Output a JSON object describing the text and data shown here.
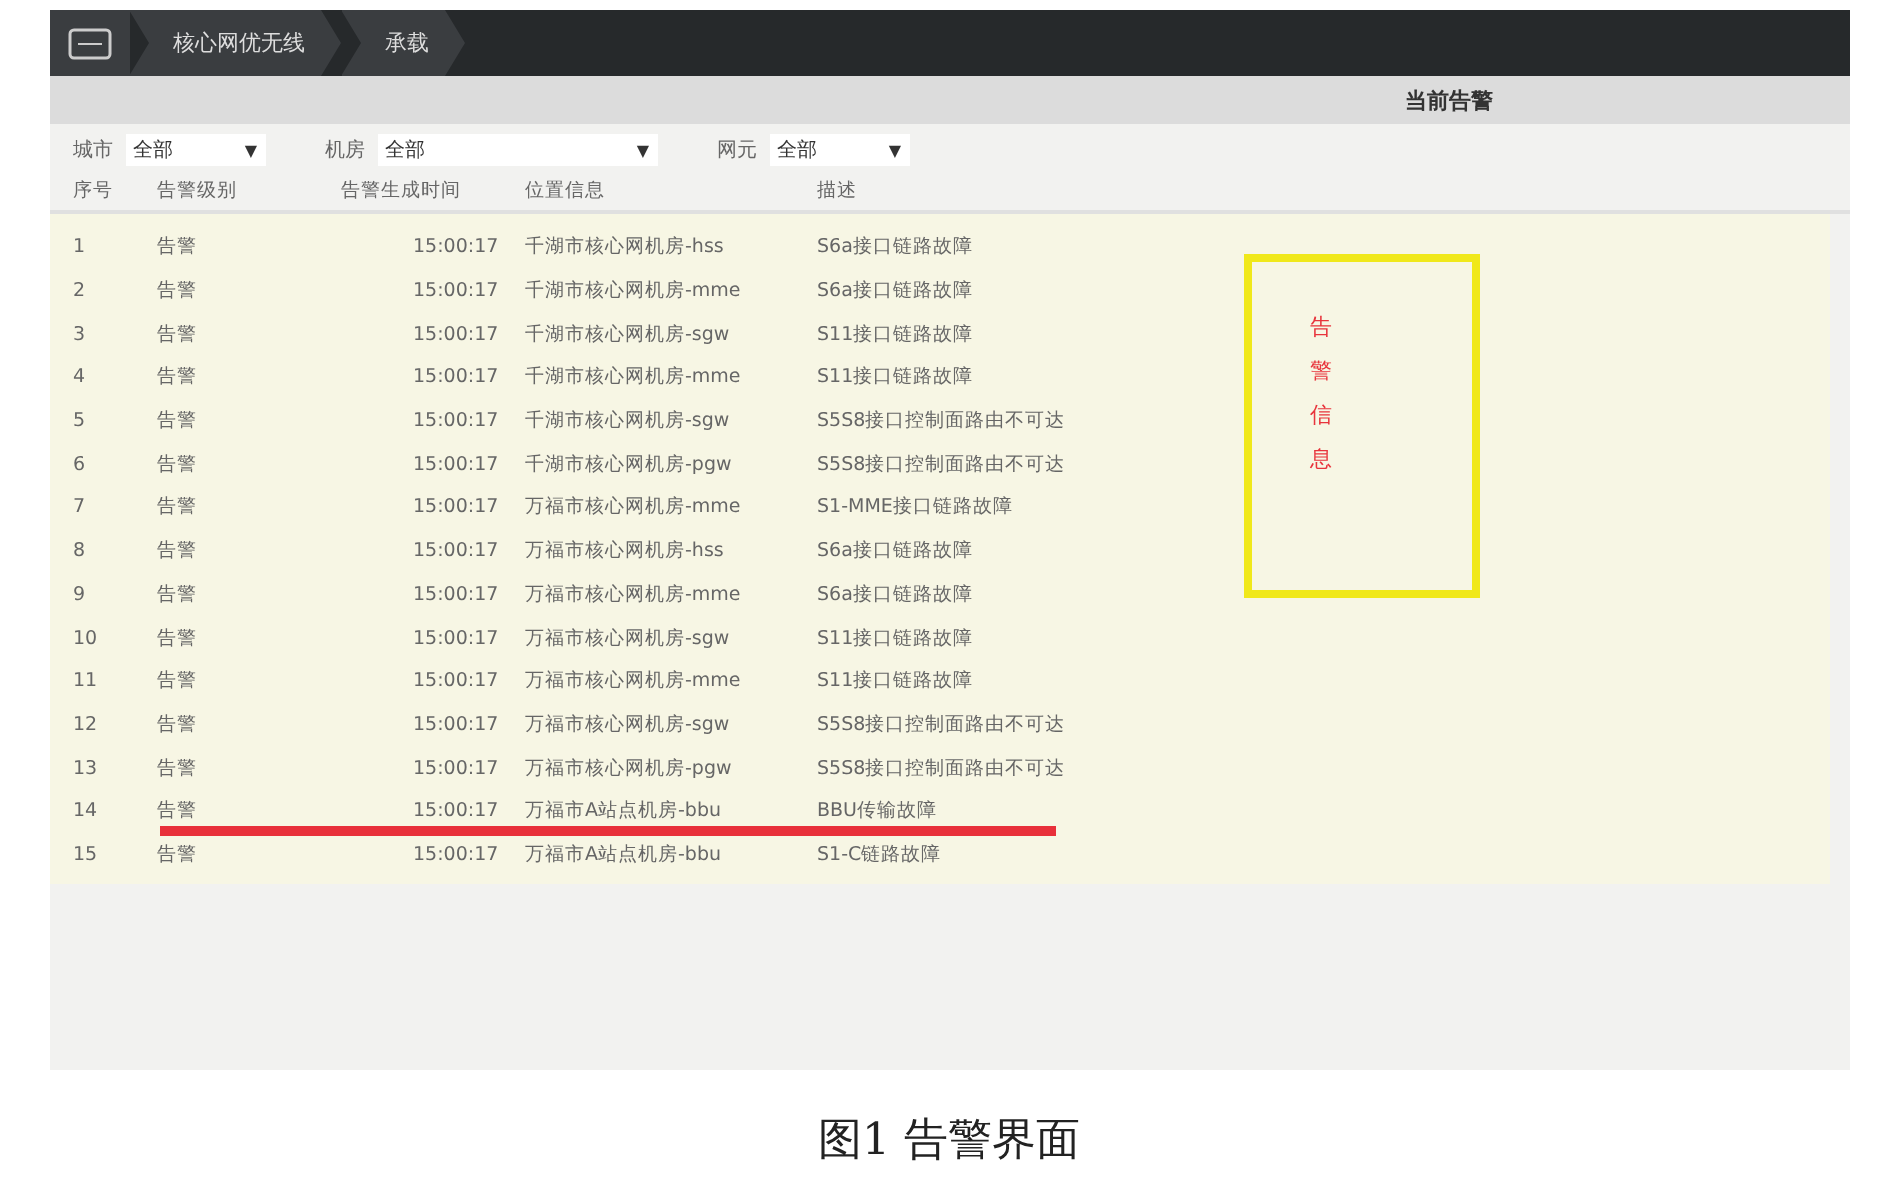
{
  "breadcrumb": [
    "核心网优无线",
    "承载"
  ],
  "panel_title": "当前告警",
  "filters": [
    {
      "label": "城市",
      "value": "全部",
      "caret": "▼"
    },
    {
      "label": "机房",
      "value": "全部",
      "caret": "▼"
    },
    {
      "label": "网元",
      "value": "全部",
      "caret": "▼"
    }
  ],
  "table": {
    "columns": [
      "序号",
      "告警级别",
      "告警生成时间",
      "位置信息",
      "描述"
    ],
    "rows": [
      [
        "1",
        "告警",
        "15:00:17",
        "千湖市核心网机房-hss",
        "S6a接口链路故障"
      ],
      [
        "2",
        "告警",
        "15:00:17",
        "千湖市核心网机房-mme",
        "S6a接口链路故障"
      ],
      [
        "3",
        "告警",
        "15:00:17",
        "千湖市核心网机房-sgw",
        "S11接口链路故障"
      ],
      [
        "4",
        "告警",
        "15:00:17",
        "千湖市核心网机房-mme",
        "S11接口链路故障"
      ],
      [
        "5",
        "告警",
        "15:00:17",
        "千湖市核心网机房-sgw",
        "S5S8接口控制面路由不可达"
      ],
      [
        "6",
        "告警",
        "15:00:17",
        "千湖市核心网机房-pgw",
        "S5S8接口控制面路由不可达"
      ],
      [
        "7",
        "告警",
        "15:00:17",
        "万福市核心网机房-mme",
        "S1-MME接口链路故障"
      ],
      [
        "8",
        "告警",
        "15:00:17",
        "万福市核心网机房-hss",
        "S6a接口链路故障"
      ],
      [
        "9",
        "告警",
        "15:00:17",
        "万福市核心网机房-mme",
        "S6a接口链路故障"
      ],
      [
        "10",
        "告警",
        "15:00:17",
        "万福市核心网机房-sgw",
        "S11接口链路故障"
      ],
      [
        "11",
        "告警",
        "15:00:17",
        "万福市核心网机房-mme",
        "S11接口链路故障"
      ],
      [
        "12",
        "告警",
        "15:00:17",
        "万福市核心网机房-sgw",
        "S5S8接口控制面路由不可达"
      ],
      [
        "13",
        "告警",
        "15:00:17",
        "万福市核心网机房-pgw",
        "S5S8接口控制面路由不可达"
      ],
      [
        "14",
        "告警",
        "15:00:17",
        "万福市A站点机房-bbu",
        "BBU传输故障"
      ],
      [
        "15",
        "告警",
        "15:00:17",
        "万福市A站点机房-bbu",
        "S1-C链路故障"
      ]
    ]
  },
  "annotation": {
    "text": "告警信息",
    "color": "#e8343c"
  },
  "caption": "图1 告警界面"
}
